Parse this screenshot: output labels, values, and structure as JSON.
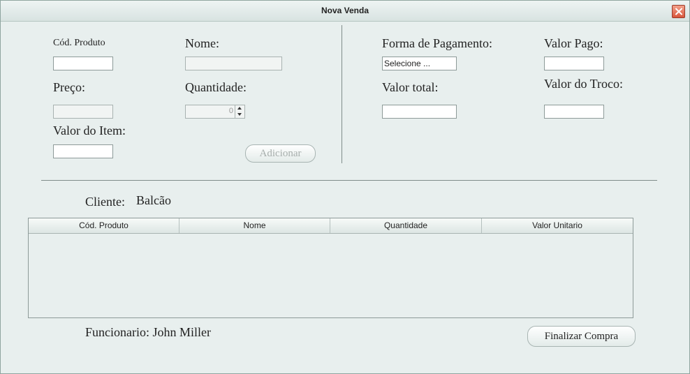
{
  "window": {
    "title": "Nova Venda"
  },
  "produto": {
    "cod_label": "Cód. Produto",
    "nome_label": "Nome:",
    "preco_label": "Preço:",
    "quantidade_label": "Quantidade:",
    "quantidade_value": "0",
    "valor_item_label": "Valor do Item:",
    "adicionar_label": "Adicionar"
  },
  "pagamento": {
    "forma_label": "Forma de Pagamento:",
    "forma_selected": "Selecione ...",
    "valor_pago_label": "Valor Pago:",
    "valor_total_label": "Valor total:",
    "valor_troco_label": "Valor do Troco:"
  },
  "cliente": {
    "label": "Cliente:",
    "value": "Balcão"
  },
  "table": {
    "columns": [
      "Cód. Produto",
      "Nome",
      "Quantidade",
      "Valor Unitario"
    ],
    "rows": []
  },
  "funcionario": {
    "text": "Funcionario: John Miller"
  },
  "finalizar_label": "Finalizar Compra"
}
